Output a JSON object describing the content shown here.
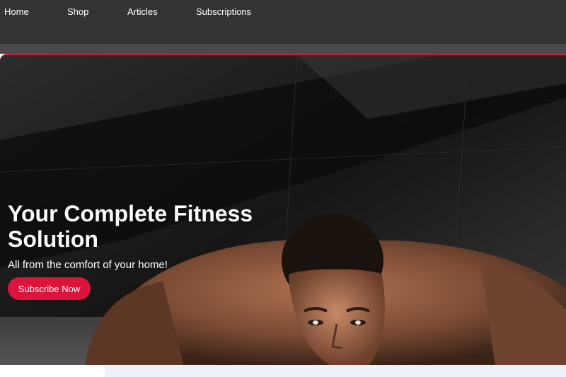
{
  "nav": {
    "items": [
      {
        "label": "Home"
      },
      {
        "label": "Shop"
      },
      {
        "label": "Articles"
      },
      {
        "label": "Subscriptions"
      }
    ]
  },
  "hero": {
    "title": "Your Complete Fitness Solution",
    "subtitle": "All from the comfort of your home!",
    "cta_label": "Subscribe Now",
    "image_subject": "man doing push-ups against dark concrete wall"
  },
  "colors": {
    "nav_background": "#333333",
    "accent": "#dc143c",
    "text_light": "#ffffff"
  }
}
